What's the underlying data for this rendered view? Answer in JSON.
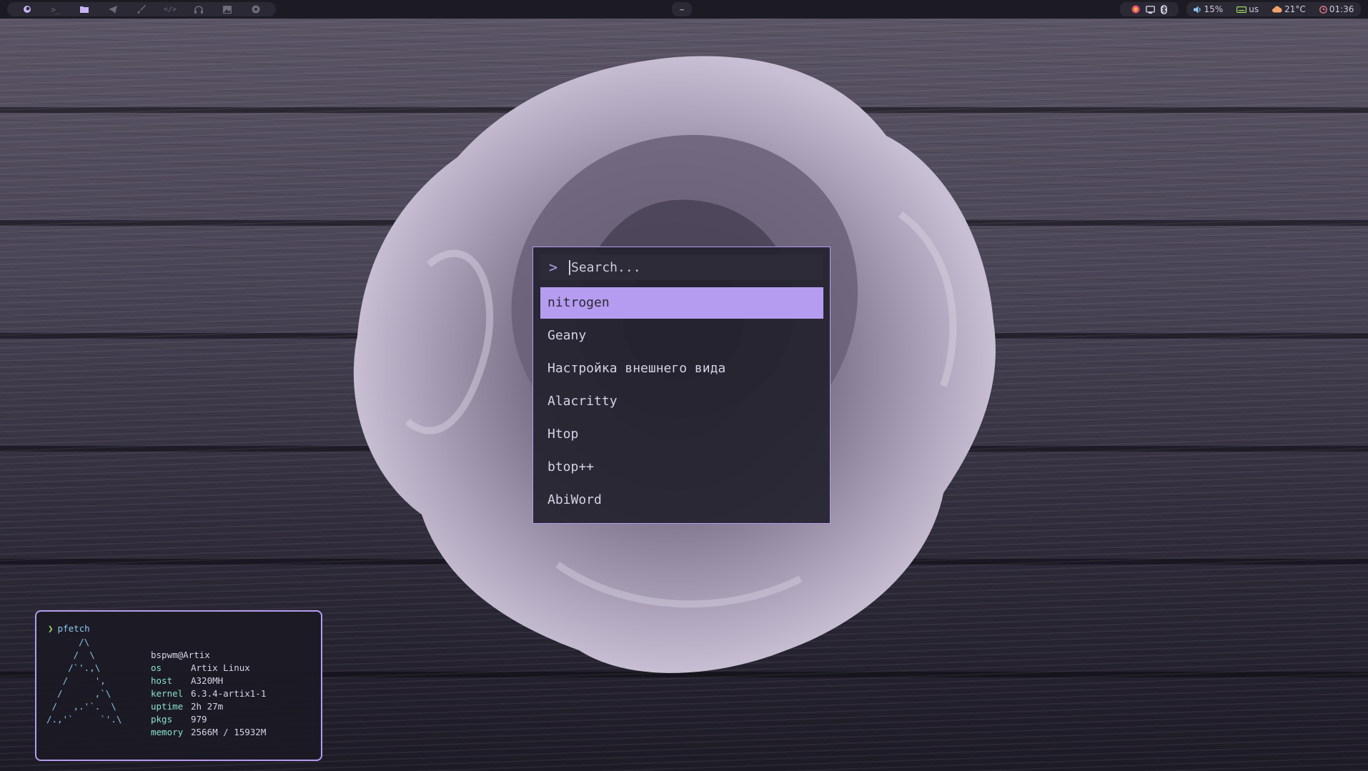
{
  "topbar": {
    "workspaces": [
      {
        "icon": "firefox-icon",
        "active": true
      },
      {
        "icon": "terminal-icon",
        "glyph": ">_"
      },
      {
        "icon": "folder-icon"
      },
      {
        "icon": "telegram-icon"
      },
      {
        "icon": "brush-icon"
      },
      {
        "icon": "code-icon",
        "glyph": "</>"
      },
      {
        "icon": "headphones-icon"
      },
      {
        "icon": "image-icon"
      },
      {
        "icon": "settings-icon"
      }
    ],
    "center_label": "~",
    "tray": [
      "app-icon",
      "window-icon",
      "bluetooth-icon"
    ],
    "volume": "15%",
    "keyboard_layout": "us",
    "weather": "21°C",
    "clock": "01:36"
  },
  "launcher": {
    "prompt": ">",
    "search_placeholder": "Search...",
    "items": [
      {
        "label": "nitrogen",
        "selected": true
      },
      {
        "label": "Geany"
      },
      {
        "label": "Настройка внешнего вида"
      },
      {
        "label": "Alacritty"
      },
      {
        "label": "Htop"
      },
      {
        "label": "btop++"
      },
      {
        "label": "AbiWord"
      }
    ]
  },
  "terminal": {
    "prompt_symbol": "❯",
    "command": "pfetch",
    "ascii_art": "      /\\\n     /  \\\n    /`'.,\\\n   /     ',\n  /      ,`\\\n /   ,.'`.  \\\n/.,'`     `'.\\",
    "user_host": "bspwm@Artix",
    "info": [
      {
        "key": "os",
        "value": "Artix Linux"
      },
      {
        "key": "host",
        "value": "A320MH"
      },
      {
        "key": "kernel",
        "value": "6.3.4-artix1-1"
      },
      {
        "key": "uptime",
        "value": "2h 27m"
      },
      {
        "key": "pkgs",
        "value": "979"
      },
      {
        "key": "memory",
        "value": "2566M / 15932M"
      }
    ]
  },
  "colors": {
    "accent": "#b69cf0",
    "bar_bg": "#1c1b24",
    "ascii": "#8bc6f0",
    "info_key": "#8be0c8"
  }
}
